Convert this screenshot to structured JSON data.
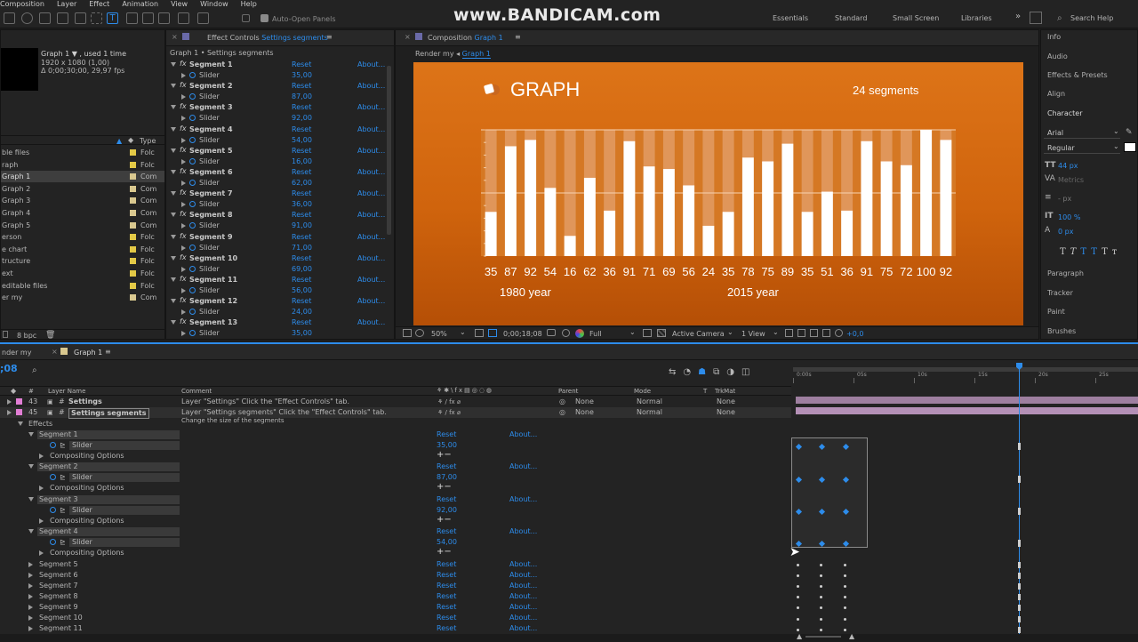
{
  "menu": [
    "Composition",
    "Layer",
    "Effect",
    "Animation",
    "View",
    "Window",
    "Help"
  ],
  "toolbar": {
    "auto_open": "Auto-Open Panels",
    "workspaces": [
      "Essentials",
      "Standard",
      "Small Screen",
      "Libraries"
    ],
    "search": "Search Help"
  },
  "watermark": "www.BANDICAM.com",
  "project": {
    "comp_name": "Graph 1 ▼ , used 1 time",
    "res": "1920 x 1080 (1,00)",
    "dur": "Δ 0;00;30;00, 29,97 fps",
    "col_type": "Type",
    "items": [
      {
        "name": "ble files",
        "type": "Folc",
        "color": "#e3c946"
      },
      {
        "name": "raph",
        "type": "Folc",
        "color": "#e3c946"
      },
      {
        "name": "Graph 1",
        "type": "Com",
        "color": "#d9c88f",
        "selected": true
      },
      {
        "name": "Graph 2",
        "type": "Com",
        "color": "#d9c88f"
      },
      {
        "name": "Graph 3",
        "type": "Com",
        "color": "#d9c88f"
      },
      {
        "name": "Graph 4",
        "type": "Com",
        "color": "#d9c88f"
      },
      {
        "name": "Graph 5",
        "type": "Com",
        "color": "#d9c88f"
      },
      {
        "name": "erson",
        "type": "Folc",
        "color": "#e3c946"
      },
      {
        "name": "e chart",
        "type": "Folc",
        "color": "#e3c946"
      },
      {
        "name": "tructure",
        "type": "Folc",
        "color": "#e3c946"
      },
      {
        "name": "ext",
        "type": "Folc",
        "color": "#e3c946"
      },
      {
        "name": "editable files",
        "type": "Folc",
        "color": "#e3c946"
      },
      {
        "name": "er my",
        "type": "Com",
        "color": "#d9c88f"
      }
    ],
    "bpc": "8 bpc"
  },
  "effects": {
    "tab": "Effect Controls",
    "tab_target": "Settings segments",
    "header": "Graph 1 • Settings segments",
    "reset": "Reset",
    "about": "About...",
    "slider": "Slider",
    "segments": [
      {
        "name": "Segment 1",
        "value": "35,00"
      },
      {
        "name": "Segment 2",
        "value": "87,00"
      },
      {
        "name": "Segment 3",
        "value": "92,00"
      },
      {
        "name": "Segment 4",
        "value": "54,00"
      },
      {
        "name": "Segment 5",
        "value": "16,00"
      },
      {
        "name": "Segment 6",
        "value": "62,00"
      },
      {
        "name": "Segment 7",
        "value": "36,00"
      },
      {
        "name": "Segment 8",
        "value": "91,00"
      },
      {
        "name": "Segment 9",
        "value": "71,00"
      },
      {
        "name": "Segment 10",
        "value": "69,00"
      },
      {
        "name": "Segment 11",
        "value": "56,00"
      },
      {
        "name": "Segment 12",
        "value": "24,00"
      },
      {
        "name": "Segment 13",
        "value": "35,00"
      }
    ]
  },
  "comp": {
    "tab": "Composition",
    "tab_target": "Graph 1",
    "crumb1": "Render my",
    "crumb2": "Graph 1",
    "zoom": "50%",
    "timecode": "0;00;18;08",
    "res": "Full",
    "camera": "Active Camera",
    "views": "1 View",
    "exposure": "+0,0"
  },
  "chart_data": {
    "type": "bar",
    "title": "GRAPH",
    "subtitle": "24 segments",
    "values": [
      35,
      87,
      92,
      54,
      16,
      62,
      36,
      91,
      71,
      69,
      56,
      24,
      35,
      78,
      75,
      89,
      35,
      51,
      36,
      91,
      75,
      72,
      100,
      92
    ],
    "ylim": [
      0,
      100
    ],
    "labels": [
      "1980 year",
      "2015 year"
    ],
    "colors": {
      "bg": "#d2680f",
      "bar": "#ffffff",
      "track": "#e0965a"
    }
  },
  "right_panel": {
    "items": [
      "Info",
      "Audio",
      "Effects & Presets",
      "Align",
      "Character"
    ],
    "font": "Arial",
    "style": "Regular",
    "size": "44 px",
    "kerning": "Metrics",
    "tracking": "- px",
    "scale": "100 %",
    "baseline": "0 px",
    "bottom_items": [
      "Paragraph",
      "Tracker",
      "Paint",
      "Brushes"
    ]
  },
  "timeline": {
    "tab_prev": "nder my",
    "tab": "Graph 1",
    "timecode": ";08",
    "col_layer": "Layer Name",
    "col_comment": "Comment",
    "col_parent": "Parent",
    "col_mode": "Mode",
    "col_t": "T",
    "col_trkmat": "TrkMat",
    "layers": [
      {
        "num": "43",
        "name": "Settings",
        "comment": "Layer \"Settings\" Click the \"Effect Controls\" tab.",
        "color": "#e27ed5"
      },
      {
        "num": "45",
        "name": "Settings segments",
        "comment": "Layer \"Settings segments\" Click the \"Effect Controls\" tab.",
        "comment2": "Change the size of the segments",
        "color": "#e27ed5"
      }
    ],
    "parent": "None",
    "mode": "Normal",
    "trkmat": "None",
    "effects_label": "Effects",
    "compositing": "Compositing Options",
    "seg_values": [
      "35,00",
      "87,00",
      "92,00",
      "54,00"
    ],
    "collapsed": [
      "Segment 5",
      "Segment 6",
      "Segment 7",
      "Segment 8",
      "Segment 9",
      "Segment 10",
      "Segment 11"
    ],
    "ruler": [
      "0:00s",
      "05s",
      "10s",
      "15s",
      "20s",
      "25s"
    ]
  }
}
